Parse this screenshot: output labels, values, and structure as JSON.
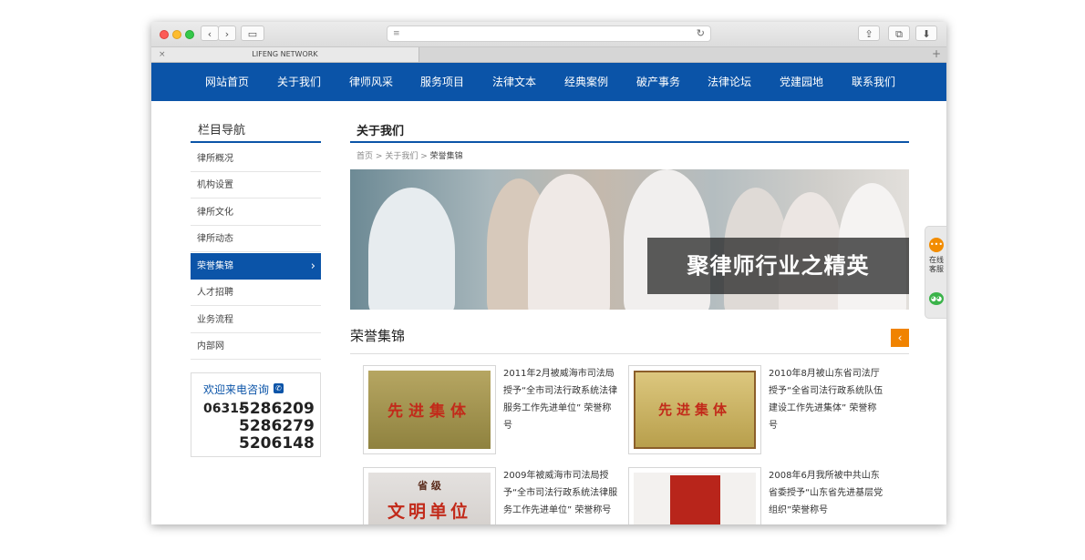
{
  "browser": {
    "tab_title": "LIFENG NETWORK",
    "nav_back": "‹",
    "nav_forward": "›",
    "sidebar_toggle": "▭",
    "reader": "≡",
    "reload": "↻",
    "share": "⇪",
    "duplicate": "⧉",
    "download": "⬇",
    "tab_close": "×",
    "new_tab": "+"
  },
  "nav": {
    "items": [
      {
        "label": "网站首页"
      },
      {
        "label": "关于我们"
      },
      {
        "label": "律师风采"
      },
      {
        "label": "服务项目"
      },
      {
        "label": "法律文本"
      },
      {
        "label": "经典案例"
      },
      {
        "label": "破产事务"
      },
      {
        "label": "法律论坛"
      },
      {
        "label": "党建园地"
      },
      {
        "label": "联系我们"
      }
    ]
  },
  "sidebar": {
    "title": "栏目导航",
    "items": [
      {
        "label": "律所概况"
      },
      {
        "label": "机构设置"
      },
      {
        "label": "律所文化"
      },
      {
        "label": "律所动态"
      },
      {
        "label": "荣誉集锦"
      },
      {
        "label": "人才招聘"
      },
      {
        "label": "业务流程"
      },
      {
        "label": "内部网"
      }
    ],
    "active_chevron": "›",
    "contact": {
      "title": "欢迎来电咨询",
      "phone_icon": "✆",
      "prefix": "0631-",
      "numbers": [
        "5286209",
        "5286279",
        "5206148"
      ]
    }
  },
  "main": {
    "title": "关于我们",
    "breadcrumb": {
      "home": "首页",
      "sep1": ">",
      "parent": "关于我们",
      "sep2": ">",
      "current": "荣誉集锦"
    },
    "banner_slogan": "聚律师行业之精英",
    "section_title": "荣誉集锦",
    "section_btn": "‹",
    "honors": [
      {
        "text": "2011年2月被威海市司法局授予“全市司法行政系统法律服务工作先进单位” 荣誉称号",
        "plaque_big": "先进集体"
      },
      {
        "text": "2010年8月被山东省司法厅授予“全省司法行政系统队伍建设工作先进集体” 荣誉称号",
        "plaque_big": "先进集体"
      },
      {
        "text": "2009年被威海市司法局授予“全市司法行政系统法律服务工作先进单位” 荣誉称号",
        "plaque_big": "文明单位",
        "plaque_head": "省 级"
      },
      {
        "text": "2008年6月我所被中共山东省委授予“山东省先进基层党组织”荣誉称号"
      }
    ]
  },
  "float": {
    "service_icon": "•••",
    "service_label_1": "在线",
    "service_label_2": "客服",
    "wechat_icon": "◕◕"
  },
  "colors": {
    "nav_blue": "#0b54a8",
    "accent_orange": "#f08300"
  }
}
